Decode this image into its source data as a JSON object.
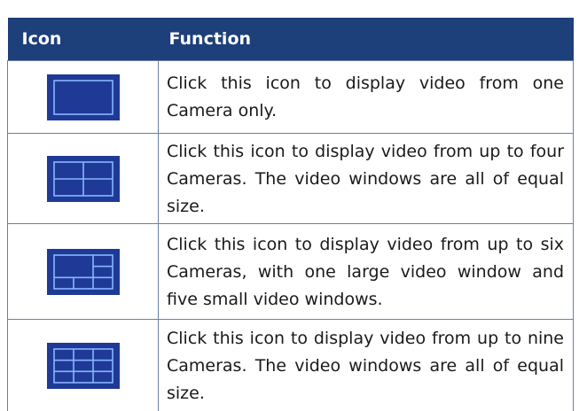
{
  "header": {
    "icon_label": "Icon",
    "function_label": "Function"
  },
  "rows": [
    {
      "icon": "single-view-layout-icon",
      "text": "Click this icon to display video from one Camera only."
    },
    {
      "icon": "quad-view-layout-icon",
      "text": "Click this icon to display video from up to four Cameras. The video windows are all of equal size."
    },
    {
      "icon": "six-view-layout-icon",
      "text": "Click this icon to display video from up to six Cameras, with one large video window and five small video windows."
    },
    {
      "icon": "nine-view-layout-icon",
      "text": "Click this icon to display video from up to nine Cameras. The video windows are all of equal size."
    }
  ],
  "colors": {
    "header_bg": "#1d3f7a",
    "icon_bg": "#1e3a96",
    "icon_lines": "#8ab4ff",
    "border": "#6b7fa5"
  }
}
